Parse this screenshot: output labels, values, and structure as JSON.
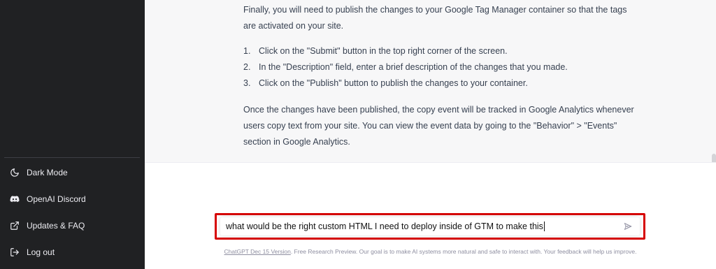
{
  "sidebar": {
    "items": [
      {
        "label": "Dark Mode",
        "icon": "moon-icon"
      },
      {
        "label": "OpenAI Discord",
        "icon": "discord-icon"
      },
      {
        "label": "Updates & FAQ",
        "icon": "external-link-icon"
      },
      {
        "label": "Log out",
        "icon": "logout-icon"
      }
    ]
  },
  "answer": {
    "para1": "Finally, you will need to publish the changes to your Google Tag Manager container so that the tags are activated on your site.",
    "steps": [
      {
        "num": "1.",
        "text": "Click on the \"Submit\" button in the top right corner of the screen."
      },
      {
        "num": "2.",
        "text": "In the \"Description\" field, enter a brief description of the changes that you made."
      },
      {
        "num": "3.",
        "text": "Click on the \"Publish\" button to publish the changes to your container."
      }
    ],
    "para2": "Once the changes have been published, the copy event will be tracked in Google Analytics whenever users copy text from your site. You can view the event data by going to the \"Behavior\" > \"Events\" section in Google Analytics."
  },
  "composer": {
    "input_value": "what would be the right custom HTML I need to deploy inside of GTM to make this",
    "highlight_color": "#d60000"
  },
  "footer": {
    "link_text": "ChatGPT Dec 15 Version",
    "text": ". Free Research Preview. Our goal is to make AI systems more natural and safe to interact with. Your feedback will help us improve."
  }
}
